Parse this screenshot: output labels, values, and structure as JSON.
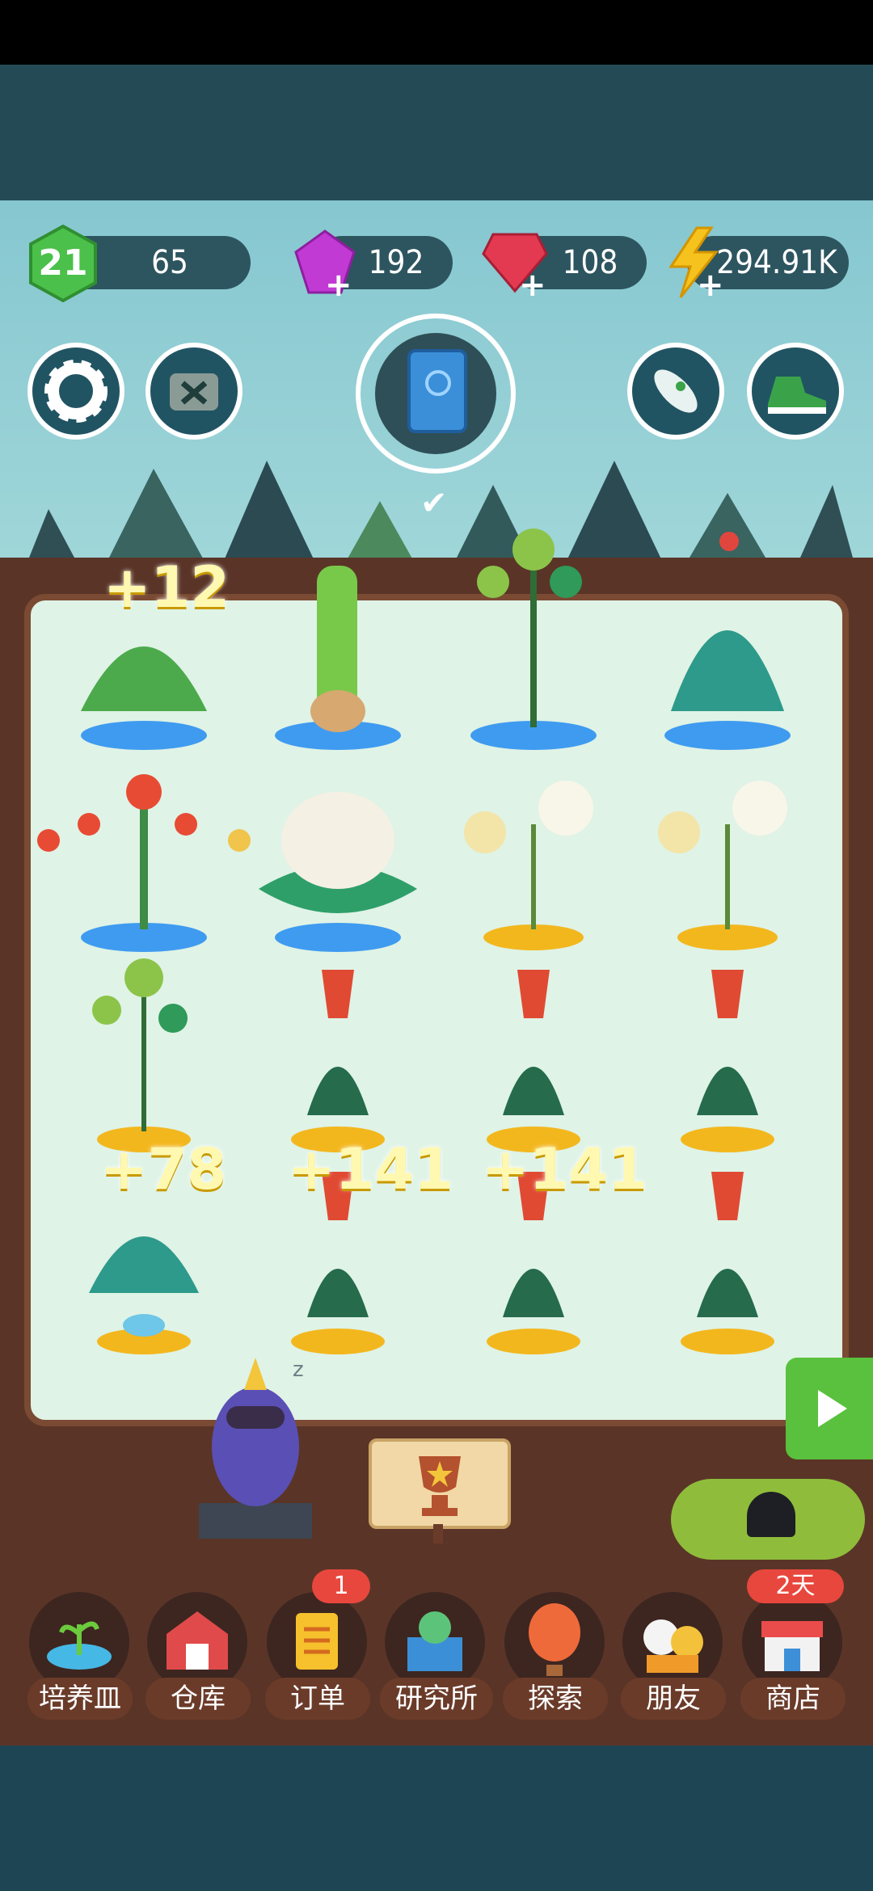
{
  "hud": {
    "level": "21",
    "xp": "65",
    "gems": "192",
    "rubies": "108",
    "energy": "294.91K"
  },
  "floating_rewards": [
    "+12",
    "+78",
    "+141",
    "+141"
  ],
  "nav": {
    "items": [
      {
        "label": "培养皿",
        "icon": "petri-dish-sprout-icon"
      },
      {
        "label": "仓库",
        "icon": "barn-icon"
      },
      {
        "label": "订单",
        "icon": "order-scroll-icon",
        "badge": "1"
      },
      {
        "label": "研究所",
        "icon": "laboratory-icon"
      },
      {
        "label": "探索",
        "icon": "hot-air-balloon-icon"
      },
      {
        "label": "朋友",
        "icon": "friends-icon"
      },
      {
        "label": "商店",
        "icon": "shop-icon",
        "badge": "2天"
      }
    ]
  },
  "colors": {
    "board": "#dff3e6",
    "soil": "#5a3527",
    "accent": "#59c13d",
    "hud_pill": "#2d5560"
  }
}
